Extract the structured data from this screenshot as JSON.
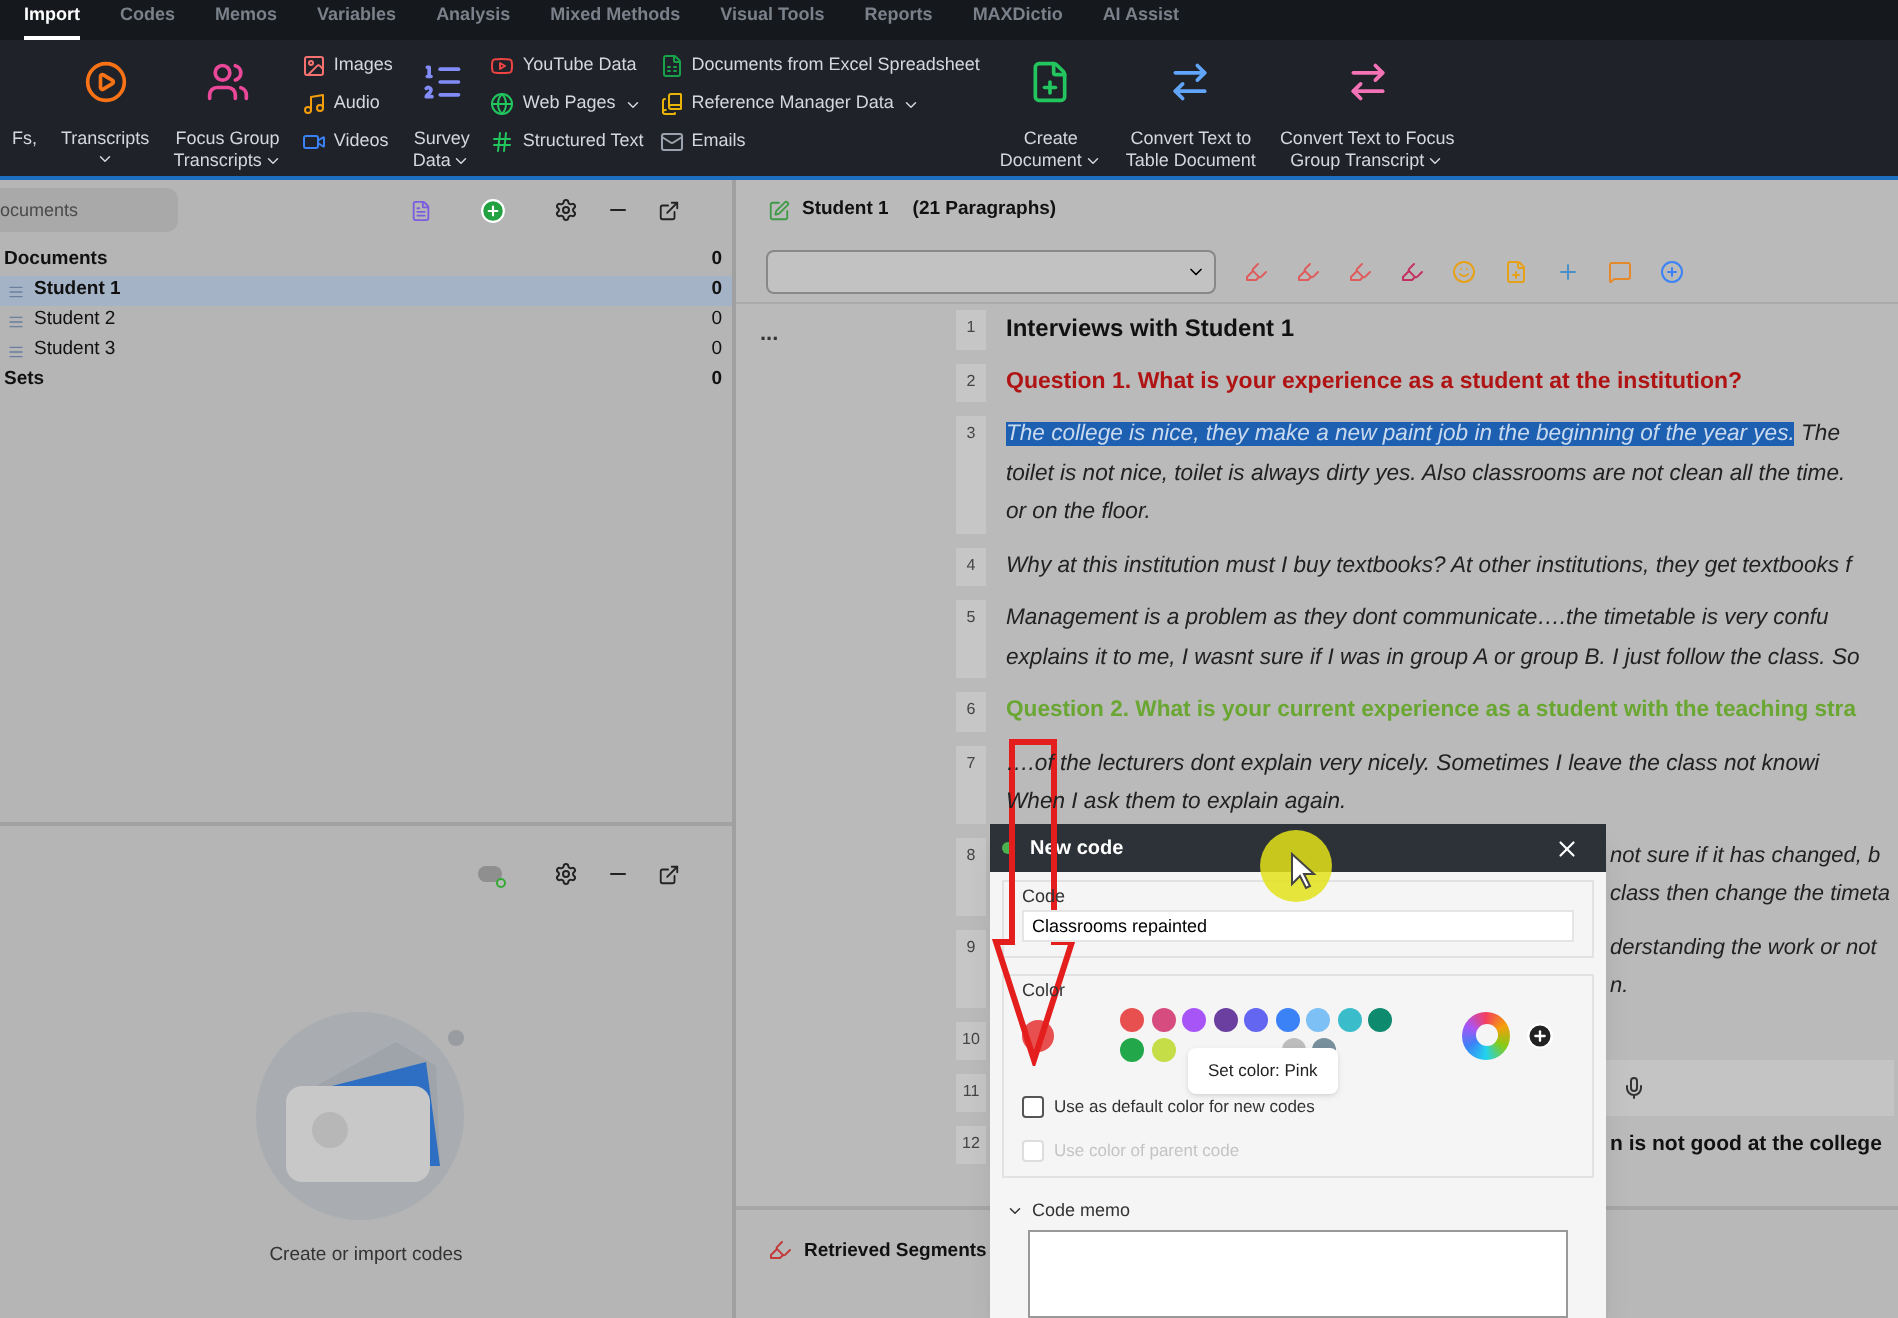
{
  "menu_tabs": [
    {
      "label": "Import",
      "selected": true
    },
    {
      "label": "Codes",
      "selected": false
    },
    {
      "label": "Memos",
      "selected": false
    },
    {
      "label": "Variables",
      "selected": false
    },
    {
      "label": "Analysis",
      "selected": false
    },
    {
      "label": "Mixed Methods",
      "selected": false
    },
    {
      "label": "Visual Tools",
      "selected": false
    },
    {
      "label": "Reports",
      "selected": false
    },
    {
      "label": "MAXDictio",
      "selected": false
    },
    {
      "label": "AI Assist",
      "selected": false
    }
  ],
  "ribbon": [
    {
      "kind": "large",
      "label_lines": [
        "Fs,"
      ],
      "dropdown": false
    },
    {
      "kind": "large",
      "label_lines": [
        "Transcripts"
      ],
      "dropdown": true
    },
    {
      "kind": "large",
      "label_lines": [
        "Focus Group",
        "Transcripts"
      ],
      "dropdown": true
    },
    {
      "kind": "stack",
      "items": [
        {
          "label": "Images",
          "dropdown": false
        },
        {
          "label": "Audio",
          "dropdown": false
        },
        {
          "label": "Videos",
          "dropdown": false
        }
      ]
    },
    {
      "kind": "large",
      "label_lines": [
        "Survey",
        "Data"
      ],
      "dropdown": true
    },
    {
      "kind": "stack",
      "items": [
        {
          "label": "YouTube Data",
          "dropdown": false
        },
        {
          "label": "Web Pages",
          "dropdown": true
        },
        {
          "label": "Structured Text",
          "dropdown": false
        }
      ]
    },
    {
      "kind": "stack",
      "items": [
        {
          "label": "Documents from Excel Spreadsheet",
          "dropdown": false
        },
        {
          "label": "Reference Manager Data",
          "dropdown": true
        },
        {
          "label": "Emails",
          "dropdown": false
        }
      ]
    },
    {
      "kind": "large",
      "label_lines": [
        "Create",
        "Document"
      ],
      "dropdown": true
    },
    {
      "kind": "large",
      "label_lines": [
        "Convert Text to",
        "Table Document"
      ],
      "dropdown": false
    },
    {
      "kind": "large",
      "label_lines": [
        "Convert Text to Focus",
        "Group Transcript"
      ],
      "dropdown": true
    }
  ],
  "documents_panel": {
    "search_placeholder": "ocuments",
    "tree": [
      {
        "label": "Documents",
        "count": "0",
        "selected": false,
        "children": [
          {
            "label": "Student 1",
            "count": "0",
            "selected": true
          },
          {
            "label": "Student 2",
            "count": "0",
            "selected": false
          },
          {
            "label": "Student 3",
            "count": "0",
            "selected": false
          }
        ]
      },
      {
        "label": "Sets",
        "count": "0",
        "selected": false
      }
    ]
  },
  "codes_panel": {
    "empty_message": "Create or import codes"
  },
  "document": {
    "title": "Student 1",
    "subtitle": "(21 Paragraphs)",
    "more": "...",
    "paragraphs": [
      {
        "number": "1",
        "kind": "title",
        "lines": [
          "Interviews with Student 1"
        ]
      },
      {
        "number": "2",
        "kind": "question_red",
        "lines": [
          "Question 1. What is your experience as a student at the institution?"
        ]
      },
      {
        "number": "3",
        "kind": "answer",
        "highlighted": "The college is nice, they make a new paint job in the beginning of the year yes.",
        "lines": [
          " The",
          "toilet is not nice, toilet is always dirty yes. Also classrooms are not clean all the time.",
          "or on the floor."
        ]
      },
      {
        "number": "4",
        "kind": "answer",
        "lines": [
          "Why at this institution must I buy textbooks? At other institutions, they get textbooks f"
        ]
      },
      {
        "number": "5",
        "kind": "answer",
        "lines": [
          " Management is a problem as they dont communicate….the timetable is very confu",
          "explains it to me, I wasnt sure if I was in group A or group B. I just follow the class. So"
        ]
      },
      {
        "number": "6",
        "kind": "question_green",
        "lines": [
          "Question 2. What is your current experience as a student with the teaching stra"
        ]
      },
      {
        "number": "7",
        "kind": "answer",
        "lines": [
          "….of the lecturers dont explain very nicely. Sometimes I leave the class not knowi",
          "When I ask them to explain again."
        ]
      },
      {
        "number": "8",
        "kind": "answer_partial",
        "lines": [
          "not sure if it has changed, b",
          "class then change the timeta"
        ]
      },
      {
        "number": "9",
        "kind": "answer_partial",
        "lines": [
          "derstanding the work or not",
          "n."
        ]
      },
      {
        "number": "10",
        "kind": "empty"
      },
      {
        "number": "11",
        "kind": "empty"
      },
      {
        "number": "12",
        "kind": "bold_partial",
        "lines": [
          "n is not good at the college"
        ]
      }
    ]
  },
  "retrieved_segments": {
    "title": "Retrieved Segments"
  },
  "dialog": {
    "title": "New code",
    "code_label": "Code",
    "code_value": "Classrooms repainted",
    "color_label": "Color",
    "selected_color": {
      "color": "#e8504f"
    },
    "palette_row1": [
      {
        "color": "#e8504f"
      },
      {
        "color": "#d64c7f"
      },
      {
        "color": "#a855f7"
      },
      {
        "color": "#6b3fa0"
      },
      {
        "color": "#6366f1"
      },
      {
        "color": "#3b82f6"
      },
      {
        "color": "#7cc0f5"
      },
      {
        "color": "#3bbccb"
      },
      {
        "color": "#0e8a6e"
      }
    ],
    "palette_row2": [
      {
        "color": "#22a84a"
      },
      {
        "color": "#c5dd47"
      },
      {
        "color": "#bdbdbd"
      },
      {
        "color": "#78909c"
      }
    ],
    "tooltip": "Set color: Pink",
    "checkboxes": [
      {
        "label": "Use as default color for new codes",
        "checked": false,
        "disabled": false
      },
      {
        "label": "Use color of parent code",
        "checked": false,
        "disabled": true
      }
    ],
    "memo": {
      "label": "Code memo",
      "expanded": true
    }
  }
}
